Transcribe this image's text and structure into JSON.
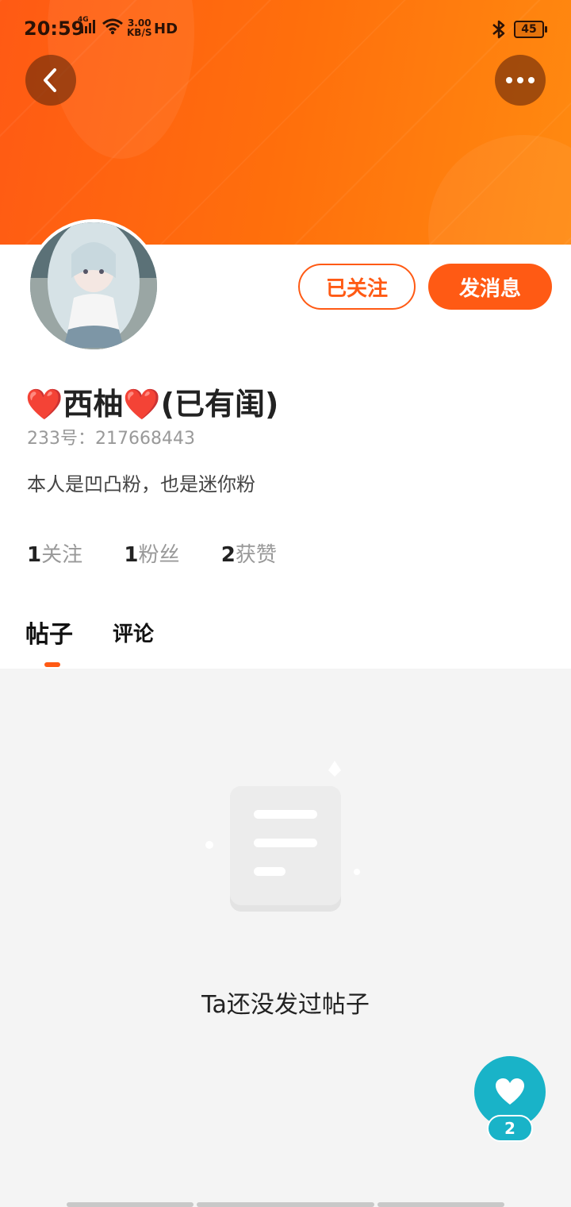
{
  "status_bar": {
    "time": "20:59",
    "network": "4G",
    "speed_top": "3.00",
    "speed_unit": "KB/S",
    "hd": "HD",
    "battery": "45"
  },
  "header": {
    "back_icon": "chevron-left-icon",
    "more_icon": "more-horizontal-icon",
    "accent_color": "#ff5a14"
  },
  "profile": {
    "name": "❤️西柚❤️(已有闺)",
    "uid": "233号：217668443",
    "bio": "本人是凹凸粉，也是迷你粉",
    "follow_button": "已关注",
    "message_button": "发消息",
    "stats": [
      {
        "count": "1",
        "label": "关注"
      },
      {
        "count": "1",
        "label": "粉丝"
      },
      {
        "count": "2",
        "label": "获赞"
      }
    ]
  },
  "tabs": [
    {
      "label": "帖子",
      "active": true
    },
    {
      "label": "评论",
      "active": false
    }
  ],
  "empty_state": {
    "icon": "document-icon",
    "text": "Ta还没发过帖子"
  },
  "fab": {
    "icon": "heart-icon",
    "count": "2",
    "color": "#19b3c8"
  }
}
